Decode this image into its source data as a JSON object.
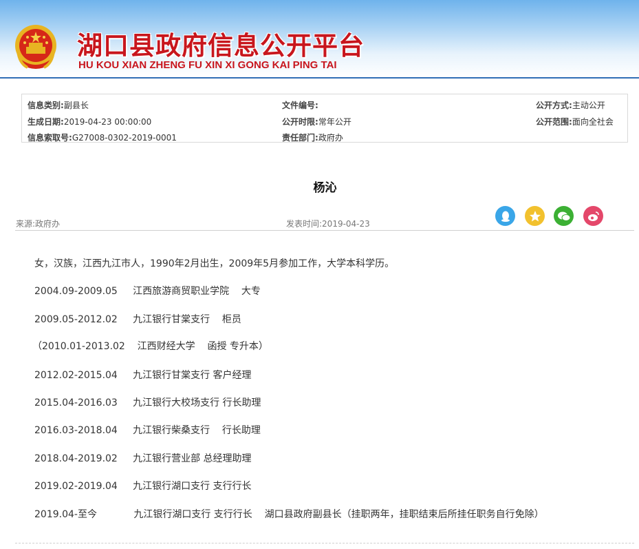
{
  "header": {
    "title": "湖口县政府信息公开平台",
    "pinyin": "HU KOU XIAN ZHENG FU XIN XI GONG KAI PING TAI"
  },
  "meta": {
    "category_label": "信息类别:",
    "category_value": "副县长",
    "doc_no_label": "文件编号:",
    "doc_no_value": "",
    "open_method_label": "公开方式:",
    "open_method_value": "主动公开",
    "created_label": "生成日期:",
    "created_value": "2019-04-23 00:00:00",
    "open_period_label": "公开时限:",
    "open_period_value": "常年公开",
    "open_scope_label": "公开范围:",
    "open_scope_value": "面向全社会",
    "index_label": "信息索取号:",
    "index_value": "G27008-0302-2019-0001",
    "dept_label": "责任部门:",
    "dept_value": "政府办"
  },
  "article": {
    "title": "杨沁",
    "source": "来源:政府办",
    "pubtime": "发表时间:2019-04-23",
    "paragraphs": [
      "女，汉族，江西九江市人，1990年2月出生，2009年5月参加工作，大学本科学历。",
      "2004.09-2009.05     江西旅游商贸职业学院    大专",
      "2009.05-2012.02     九江银行甘棠支行    柜员",
      "（2010.01-2013.02    江西财经大学    函授 专升本）",
      "2012.02-2015.04     九江银行甘棠支行 客户经理",
      "2015.04-2016.03     九江银行大校场支行 行长助理",
      "2016.03-2018.04     九江银行柴桑支行    行长助理",
      "2018.04-2019.02     九江银行营业部 总经理助理",
      "2019.02-2019.04     九江银行湖口支行 支行行长",
      "2019.04-至今            九江银行湖口支行 支行行长    湖口县政府副县长（挂职两年，挂职结束后所挂任职务自行免除）"
    ]
  },
  "share_icons": [
    {
      "name": "qq-icon",
      "color": "#3aa6e8"
    },
    {
      "name": "qzone-icon",
      "color": "#f2c12e"
    },
    {
      "name": "wechat-icon",
      "color": "#3cb034"
    },
    {
      "name": "weibo-icon",
      "color": "#e4476a"
    }
  ],
  "colors": {
    "title_red": "#c8161d",
    "header_blue": "#2f6db5"
  }
}
